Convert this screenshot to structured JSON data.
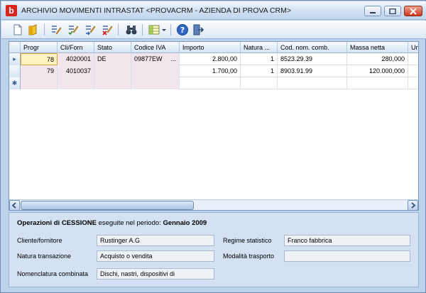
{
  "window": {
    "app_icon_letter": "b",
    "title": "ARCHIVIO MOVIMENTI INTRASTAT <PROVACRM - AZIENDA DI PROVA CRM>"
  },
  "toolbar": {
    "icons": [
      "new-icon",
      "open-icon",
      "edit-icon",
      "edit-confirm-icon",
      "edit-next-icon",
      "delete-icon",
      "search-binoculars-icon",
      "view-options-icon",
      "help-icon",
      "exit-icon"
    ]
  },
  "grid": {
    "columns": [
      "Progr",
      "Cli/Forn",
      "Stato",
      "Codice IVA",
      "Importo",
      "Natura ...",
      "Cod. nom. comb.",
      "Massa netta",
      "Un"
    ],
    "rows": [
      {
        "indicator": "▸",
        "progr": "78",
        "cliforn": "4020001",
        "stato": "DE",
        "codice_iva": "09877EW",
        "codice_iva_more": "...",
        "importo": "2.800,00",
        "natura": "1",
        "cod_nom": "8523.29.39",
        "massa": "280,000",
        "un": ""
      },
      {
        "indicator": "",
        "progr": "79",
        "cliforn": "4010037",
        "stato": "",
        "codice_iva": "",
        "codice_iva_more": "",
        "importo": "1.700,00",
        "natura": "1",
        "cod_nom": "8903.91.99",
        "massa": "120.000,000",
        "un": ""
      },
      {
        "indicator": "✱",
        "progr": "",
        "cliforn": "",
        "stato": "",
        "codice_iva": "",
        "codice_iva_more": "",
        "importo": "",
        "natura": "",
        "cod_nom": "",
        "massa": "",
        "un": ""
      }
    ]
  },
  "panel": {
    "title_prefix": "Operazioni di",
    "title_type": "CESSIONE",
    "title_middle": "eseguite nel periodo:",
    "title_period": "Gennaio 2009",
    "cliente_label": "Cliente/fornitore",
    "cliente_value": "Rustinger A.G",
    "natura_label": "Natura transazione",
    "natura_value": "Acquisto o vendita",
    "nomenclatura_label": "Nomenclatura combinata",
    "nomenclatura_value": "Dischi, nastri, dispositivi di",
    "regime_label": "Regime statistico",
    "regime_value": "Franco fabbrica",
    "modalita_label": "Modalità trasporto",
    "modalita_value": ""
  }
}
